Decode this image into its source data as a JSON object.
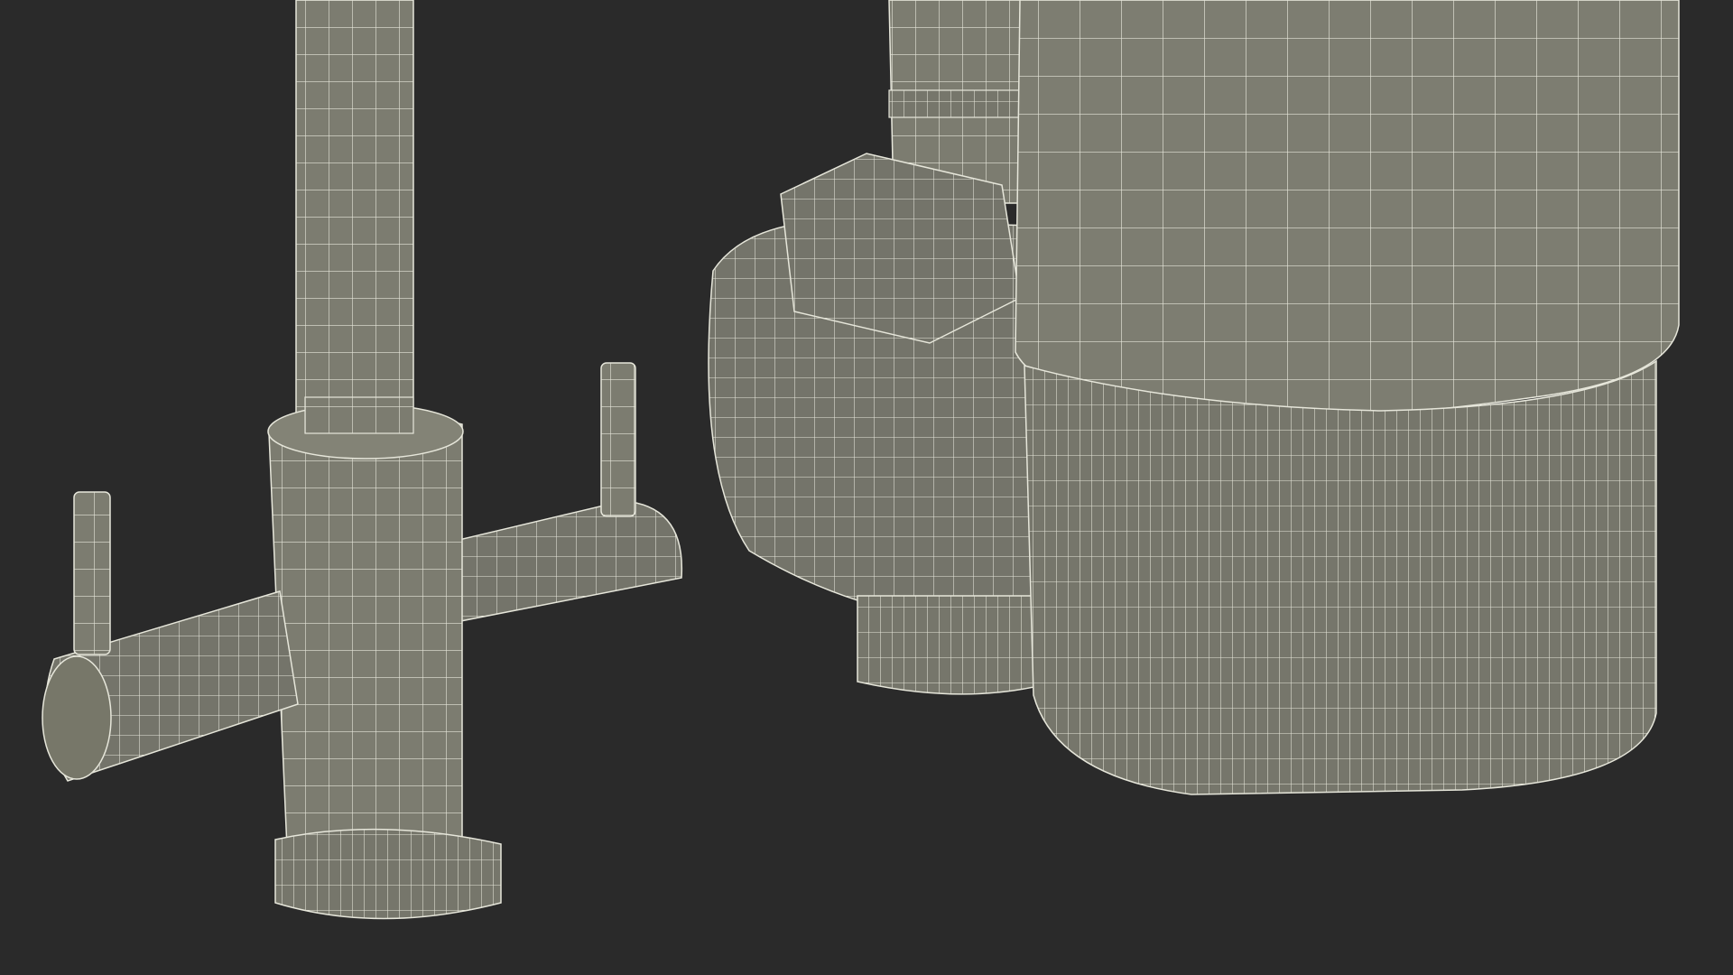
{
  "scene": {
    "background_color": "#2a2a2a",
    "mesh_fill_color": "#7c7c70",
    "mesh_shade_color": "#6c6c62",
    "wire_color": "#e6e6da",
    "objects": [
      "faucet-wireframe",
      "filter-unit-wireframe"
    ]
  }
}
